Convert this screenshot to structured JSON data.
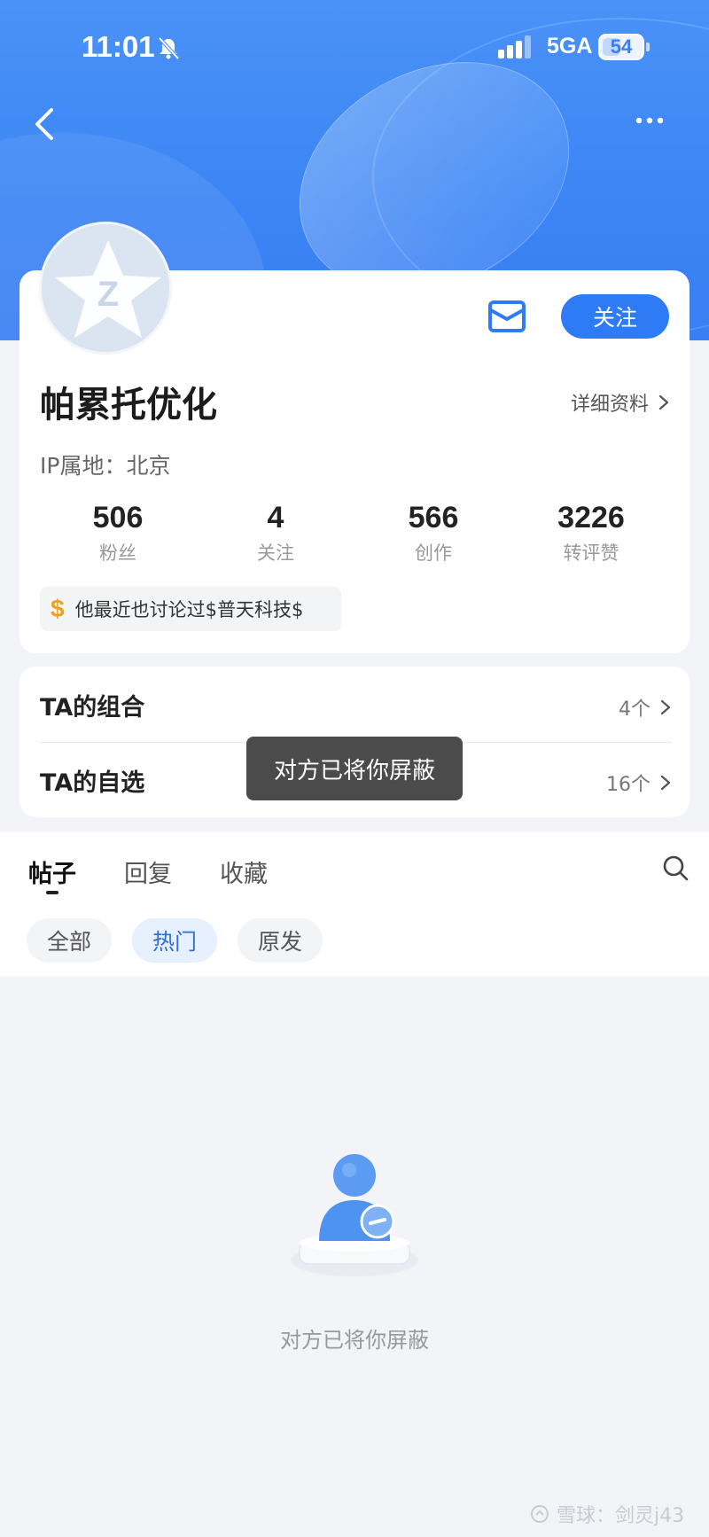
{
  "status_bar": {
    "time": "11:01",
    "network": "5GA",
    "battery": "54",
    "battery_level_percent": 54,
    "icons": [
      "bell-muted-icon",
      "signal-icon",
      "battery-icon"
    ]
  },
  "header": {
    "back_icon": "chevron-left-icon",
    "more_icon": "more-dots-icon"
  },
  "profile": {
    "name": "帕累托优化",
    "detail_label": "详细资料",
    "ip_location": "IP属地：北京",
    "follow_label": "关注",
    "mail_icon": "mail-icon",
    "stats": [
      {
        "value": "506",
        "label": "粉丝"
      },
      {
        "value": "4",
        "label": "关注"
      },
      {
        "value": "566",
        "label": "创作"
      },
      {
        "value": "3226",
        "label": "转评赞"
      }
    ],
    "discussion": "他最近也讨论过$普天科技$",
    "dollar_symbol": "$"
  },
  "lists": [
    {
      "title": "TA的组合",
      "count": "4个"
    },
    {
      "title": "TA的自选",
      "count": "16个"
    }
  ],
  "toast": "对方已将你屏蔽",
  "tabs": [
    {
      "label": "帖子",
      "active": true
    },
    {
      "label": "回复",
      "active": false
    },
    {
      "label": "收藏",
      "active": false
    }
  ],
  "filters": [
    {
      "label": "全部",
      "active": false
    },
    {
      "label": "热门",
      "active": true
    },
    {
      "label": "原发",
      "active": false
    }
  ],
  "empty_state": {
    "message": "对方已将你屏蔽"
  },
  "watermark": "雪球：剑灵j43",
  "colors": {
    "accent": "#2f7bf5",
    "header_bg": "#3b85f5",
    "chip_active_text": "#2f6fd6",
    "toast_bg": "#4b4b4b"
  }
}
